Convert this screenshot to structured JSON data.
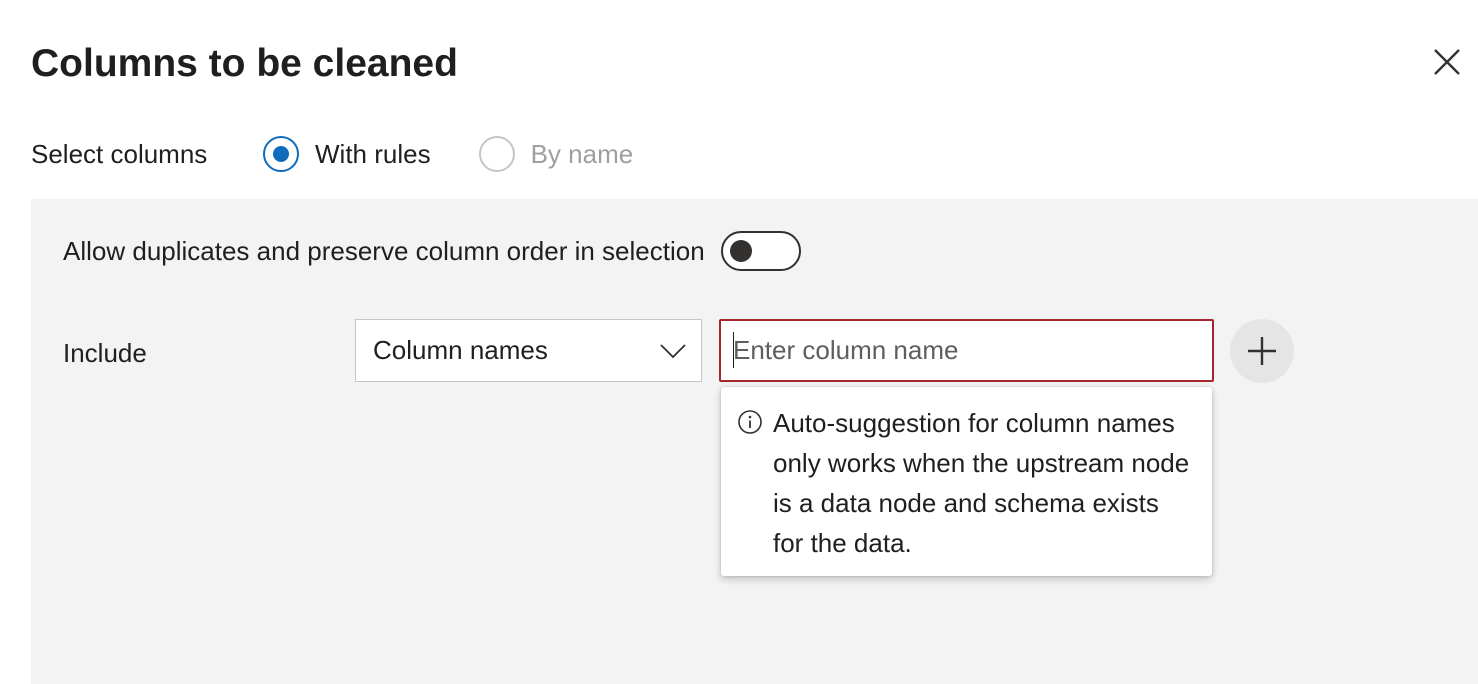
{
  "dialog": {
    "title": "Columns to be cleaned",
    "close_icon": "close-icon"
  },
  "select_columns": {
    "label": "Select columns",
    "options": [
      {
        "label": "With rules",
        "selected": true,
        "enabled": true
      },
      {
        "label": "By name",
        "selected": false,
        "enabled": false
      }
    ]
  },
  "rules": {
    "toggle_label": "Allow duplicates and preserve column order in selection",
    "toggle_on": false,
    "include_label": "Include",
    "dropdown_value": "Column names",
    "input_value": "",
    "input_placeholder": "Enter column name",
    "add_icon": "plus-icon",
    "tooltip": {
      "icon": "info-icon",
      "text": "Auto-suggestion for column names only works when the upstream node is a data node and schema exists for the data."
    }
  },
  "colors": {
    "accent": "#0f6cbd",
    "error_border": "#a4262c",
    "panel_background": "#f3f3f3"
  }
}
